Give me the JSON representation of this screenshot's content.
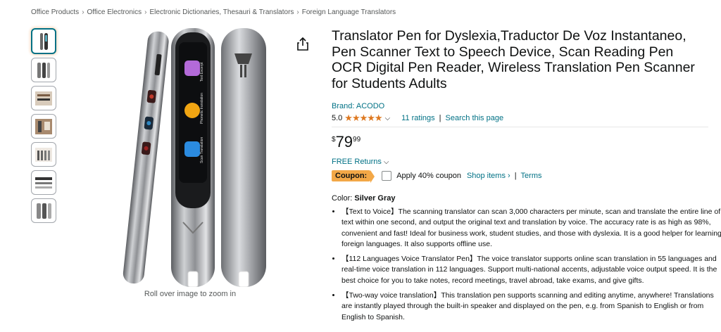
{
  "breadcrumbs": [
    "Office Products",
    "Office Electronics",
    "Electronic Dictionaries, Thesauri & Translators",
    "Foreign Language Translators"
  ],
  "breadcrumb_sep": "›",
  "zoom_hint": "Roll over image to zoom in",
  "product": {
    "title": "Translator Pen for Dyslexia,Traductor De Voz Instantaneo, Pen Scanner Text to Speech Device, Scan Reading Pen OCR Digital Pen Reader, Wireless Translation Pen Scanner for Students Adults",
    "brand": "Brand: ACODO",
    "rating_value": "5.0",
    "stars": "★★★★★",
    "ratings_count": "11 ratings",
    "search_link": "Search this page",
    "price_symbol": "$",
    "price_whole": "79",
    "price_fraction": "99",
    "returns": "FREE Returns",
    "coupon_badge": "Coupon:",
    "coupon_text": "Apply 40% coupon",
    "shop_items": "Shop items ›",
    "terms": "Terms",
    "color_label": "Color:",
    "color_value": "Silver Gray",
    "bullets": [
      "【Text to Voice】The scanning translator can scan 3,000 characters per minute, scan and translate the entire line of text within one second, and output the original text and translation by voice. The accuracy rate is as high as 98%, convenient and fast! Ideal for business work, student studies, and those with dyslexia. It is a good helper for learning foreign languages. It also supports offline use.",
      "【112 Languages Voice Translator Pen】The voice translator supports online scan translation in 55 languages and real-time voice translation in 112 languages. Support multi-national accents, adjustable voice output speed. It is the best choice for you to take notes, record meetings, travel abroad, take exams, and give gifts.",
      "【Two-way voice translation】This translation pen supports scanning and editing anytime, anywhere! Translations are instantly played through the built-in speaker and displayed on the pen, e.g. from Spanish to English or from English to Spanish."
    ]
  },
  "screen_labels": {
    "label1": "Text Excerpt",
    "label2": "Phonetic translation",
    "label3": "Scan Translation"
  },
  "colors": {
    "link": "#007185",
    "star": "#de7921",
    "coupon": "#f3a847",
    "thumb_active": "#007185"
  },
  "icons": [
    "share-icon",
    "chevron-down-icon",
    "checkbox-icon"
  ]
}
